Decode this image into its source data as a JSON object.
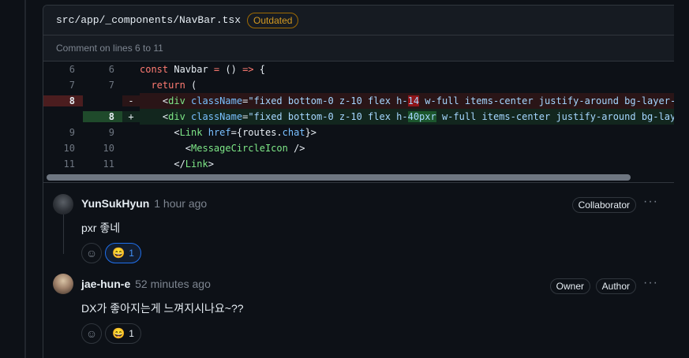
{
  "file": {
    "path": "src/app/_components/NavBar.tsx",
    "badge": "Outdated",
    "comment_lines": "Comment on lines 6 to 11"
  },
  "diff": [
    {
      "type": "ctx",
      "old": "6",
      "new": "6",
      "sign": "",
      "code": "const Navbar = () => {"
    },
    {
      "type": "ctx",
      "old": "7",
      "new": "7",
      "sign": "",
      "code": "  return ("
    },
    {
      "type": "del",
      "old": "8",
      "new": "",
      "sign": "-",
      "code": "    <div className=\"fixed bottom-0 z-10 flex h-14 w-full items-center justify-around bg-layer-"
    },
    {
      "type": "add",
      "old": "",
      "new": "8",
      "sign": "+",
      "code": "    <div className=\"fixed bottom-0 z-10 flex h-40pxr w-full items-center justify-around bg-lay"
    },
    {
      "type": "ctx",
      "old": "9",
      "new": "9",
      "sign": "",
      "code": "      <Link href={routes.chat}>"
    },
    {
      "type": "ctx",
      "old": "10",
      "new": "10",
      "sign": "",
      "code": "        <MessageCircleIcon />"
    },
    {
      "type": "ctx",
      "old": "11",
      "new": "11",
      "sign": "",
      "code": "      </Link>"
    }
  ],
  "comments": [
    {
      "author": "YunSukHyun",
      "time": "1 hour ago",
      "badges": [
        "Collaborator"
      ],
      "body": "pxr 좋네",
      "reaction_count": "1",
      "more": "···"
    },
    {
      "author": "jae-hun-e",
      "time": "52 minutes ago",
      "badges": [
        "Owner",
        "Author"
      ],
      "body": "DX가 좋아지는게 느껴지시나요~??",
      "reaction_count": "1",
      "more": "···"
    }
  ],
  "icons": {
    "smiley": "☺",
    "reaction_emoji": "😄"
  }
}
